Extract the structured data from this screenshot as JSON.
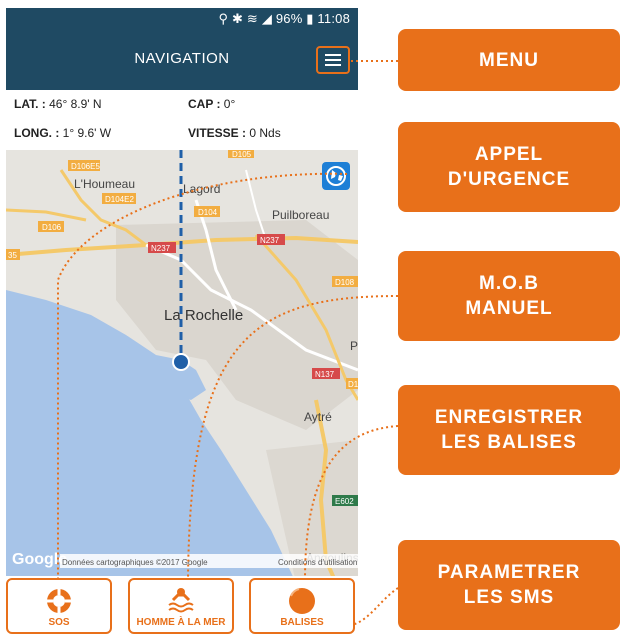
{
  "status": {
    "text": "⚲ ✱ ≋ ◢ 96% ▮ 11:08"
  },
  "header": {
    "title": "NAVIGATION"
  },
  "info": {
    "lat_label": "LAT. :",
    "lat_value": " 46° 8.9' N",
    "cap_label": "CAP :",
    "cap_value": " 0°",
    "long_label": "LONG. :",
    "long_value": " 1° 9.6' W",
    "speed_label": "VITESSE :",
    "speed_value": " 0 Nds"
  },
  "map": {
    "labels": {
      "lhoumeau": "L'Houmeau",
      "lagord": "Lagord",
      "puilboreau": "Puilboreau",
      "larochelle": "La Rochelle",
      "aytre": "Aytré",
      "angoulins": "Angoulins",
      "p": "P",
      "google": "Google",
      "attribution": "Données cartographiques ©2017 Google",
      "terms": "Conditions d'utilisation"
    },
    "roads": {
      "d106e5": "D106E5",
      "d105": "D105",
      "d104e2": "D104E2",
      "d104": "D104",
      "d106": "D106",
      "n237a": "N237",
      "n237b": "N237",
      "n137": "N137",
      "d108": "D108",
      "d1": "D1",
      "e602": "E602",
      "n35": "35"
    }
  },
  "bottom": {
    "sos": "SOS",
    "mob": "HOMME À LA MER",
    "balises": "BALISES"
  },
  "callouts": {
    "menu": [
      "MENU"
    ],
    "appel": [
      "APPEL",
      "D'URGENCE"
    ],
    "mob": [
      "M.O.B",
      "MANUEL"
    ],
    "enregistrer": [
      "ENREGISTRER",
      "LES BALISES"
    ],
    "parametrer": [
      "PARAMETRER",
      "LES SMS"
    ]
  },
  "colors": {
    "header": "#1f4a63",
    "accent": "#e8701a",
    "water": "#a7c4e8"
  }
}
